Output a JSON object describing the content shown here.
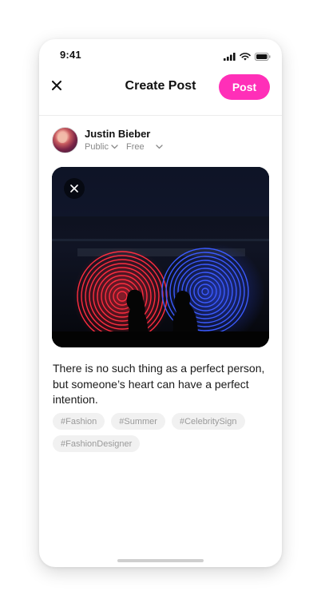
{
  "status": {
    "time": "9:41"
  },
  "header": {
    "title": "Create Post",
    "post_label": "Post"
  },
  "author": {
    "name": "Justin Bieber",
    "privacy": "Public",
    "price": "Free"
  },
  "post": {
    "caption": "There is no such thing as a perfect person, but someone’s heart can have a perfect intention.",
    "tags": [
      "#Fashion",
      "#Summer",
      "#CelebritySign",
      "#FashionDesigner"
    ]
  },
  "colors": {
    "accent": "#ff2fb8",
    "tag_bg": "#f1f1f1",
    "tag_text": "#9a9a9a"
  },
  "icons": [
    "signal-icon",
    "wifi-icon",
    "battery-icon",
    "close-icon",
    "chevron-down-icon"
  ]
}
